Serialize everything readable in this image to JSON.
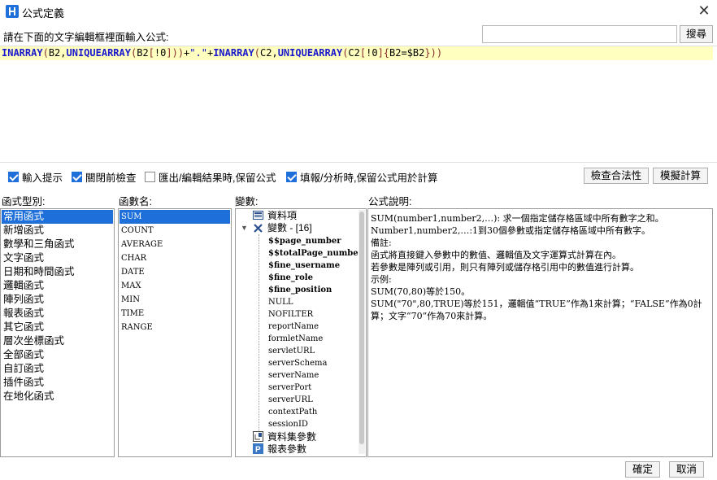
{
  "window": {
    "title": "公式定義",
    "close_glyph": "✕"
  },
  "prompt": {
    "label": "請在下面的文字編輯框裡面輸入公式:"
  },
  "search": {
    "value": "",
    "placeholder": "",
    "button_label": "搜尋"
  },
  "formula": {
    "tokens": [
      {
        "t": "INARRAY",
        "k": "fn"
      },
      {
        "t": "(",
        "k": "punc"
      },
      {
        "t": "B2,",
        "k": "txt"
      },
      {
        "t": "UNIQUEARRAY",
        "k": "fn"
      },
      {
        "t": "(",
        "k": "punc"
      },
      {
        "t": "B2",
        "k": "txt"
      },
      {
        "t": "[",
        "k": "punc"
      },
      {
        "t": "!0",
        "k": "txt"
      },
      {
        "t": "]",
        "k": "punc"
      },
      {
        "t": "))",
        "k": "punc"
      },
      {
        "t": "+",
        "k": "txt"
      },
      {
        "t": "\".\"",
        "k": "str"
      },
      {
        "t": "+",
        "k": "txt"
      },
      {
        "t": "INARRAY",
        "k": "fn"
      },
      {
        "t": "(",
        "k": "punc"
      },
      {
        "t": "C2,",
        "k": "txt"
      },
      {
        "t": "UNIQUEARRAY",
        "k": "fn"
      },
      {
        "t": "(",
        "k": "punc"
      },
      {
        "t": "C2",
        "k": "txt"
      },
      {
        "t": "[",
        "k": "punc"
      },
      {
        "t": "!0",
        "k": "txt"
      },
      {
        "t": "]",
        "k": "punc"
      },
      {
        "t": "{",
        "k": "punc"
      },
      {
        "t": "B2=$B2",
        "k": "txt"
      },
      {
        "t": "}",
        "k": "punc"
      },
      {
        "t": "))",
        "k": "punc"
      }
    ]
  },
  "options": [
    {
      "label": "輸入提示",
      "checked": true
    },
    {
      "label": "關閉前檢查",
      "checked": true
    },
    {
      "label": "匯出/編輯結果時,保留公式",
      "checked": false
    },
    {
      "label": "填報/分析時,保留公式用於計算",
      "checked": true
    }
  ],
  "actions": {
    "validate_label": "檢查合法性",
    "simulate_label": "模擬計算"
  },
  "labels": {
    "category": "函式型別:",
    "function": "函數名:",
    "variable": "變數:",
    "description": "公式說明:"
  },
  "categories": [
    "常用函式",
    "新增函式",
    "數學和三角函式",
    "文字函式",
    "日期和時間函式",
    "邏輯函式",
    "陣列函式",
    "報表函式",
    "其它函式",
    "層次坐標函式",
    "全部函式",
    "自訂函式",
    "插件函式",
    "在地化函式"
  ],
  "selected_category": 0,
  "functions": [
    "SUM",
    "COUNT",
    "AVERAGE",
    "CHAR",
    "DATE",
    "MAX",
    "MIN",
    "TIME",
    "RANGE"
  ],
  "selected_function": 0,
  "variables": {
    "dataset_item": "資料項",
    "variables_group": "變數 - [16]",
    "items": [
      "$$page_number",
      "$$totalPage_number",
      "$fine_username",
      "$fine_role",
      "$fine_position",
      "NULL",
      "NOFILTER",
      "reportName",
      "formletName",
      "servletURL",
      "serverSchema",
      "serverName",
      "serverPort",
      "serverURL",
      "contextPath",
      "sessionID"
    ],
    "bold_count": 5,
    "dataset_params": "資料集參數",
    "report_params": "報表參數"
  },
  "description": [
    "SUM(number1,number2,…): 求一個指定儲存格區域中所有數字之和。",
    "Number1,number2,…:1到30個參數或指定儲存格區域中所有數字。",
    "備註:",
    "函式將直接鍵入參數中的數值、邏輯值及文字運算式計算在內。",
    "若參數是陣列或引用，則只有陣列或儲存格引用中的數值進行計算。",
    "示例:",
    "SUM(70,80)等於150。",
    "SUM(\"70\",80,TRUE)等於151，邏輯值“TRUE”作為1來計算；“FALSE”作為0計",
    "算；文字“70”作為70來計算。"
  ],
  "footer": {
    "ok_label": "確定",
    "cancel_label": "取消"
  },
  "colors": {
    "accent": "#1e6fd9",
    "editor_highlight": "#ffffc0",
    "function_token": "#1a1acc"
  }
}
